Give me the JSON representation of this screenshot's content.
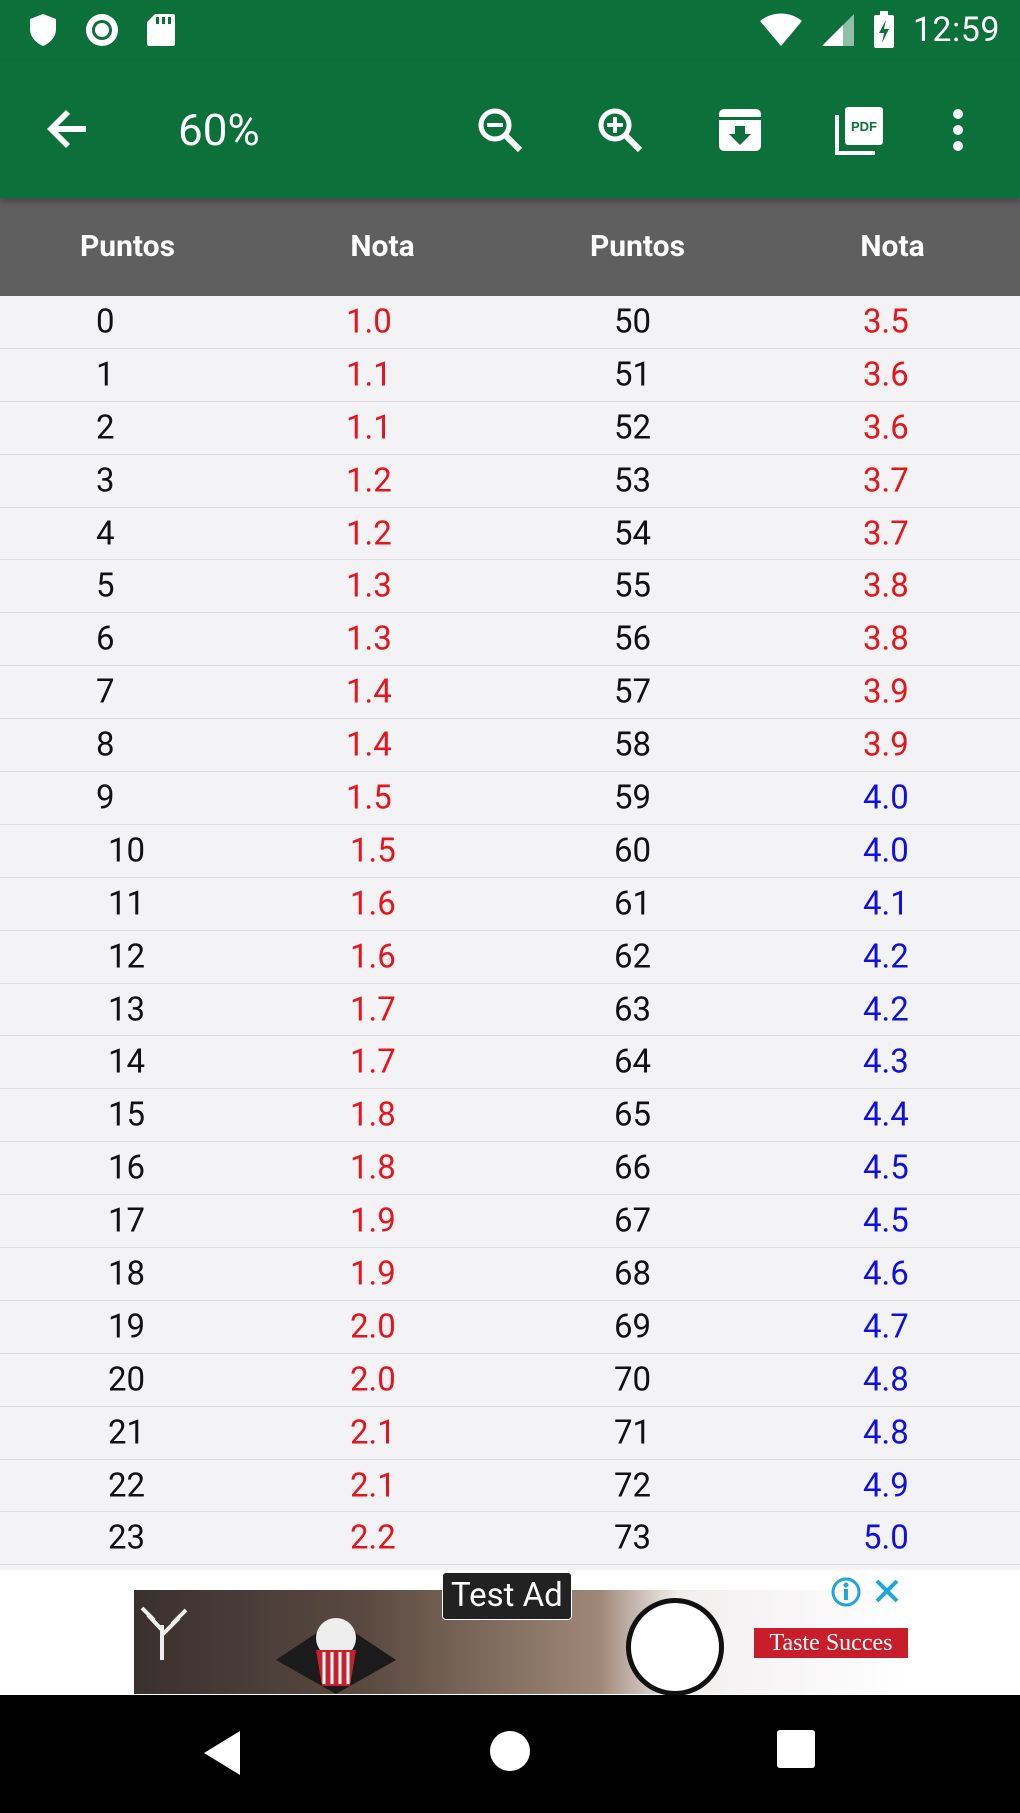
{
  "status_bar": {
    "time": "12:59"
  },
  "app_bar": {
    "zoom_label": "60%"
  },
  "table": {
    "headers": [
      "Puntos",
      "Nota",
      "Puntos",
      "Nota"
    ],
    "rows": [
      [
        "0",
        "1.0",
        "50",
        "3.5"
      ],
      [
        "1",
        "1.1",
        "51",
        "3.6"
      ],
      [
        "2",
        "1.1",
        "52",
        "3.6"
      ],
      [
        "3",
        "1.2",
        "53",
        "3.7"
      ],
      [
        "4",
        "1.2",
        "54",
        "3.7"
      ],
      [
        "5",
        "1.3",
        "55",
        "3.8"
      ],
      [
        "6",
        "1.3",
        "56",
        "3.8"
      ],
      [
        "7",
        "1.4",
        "57",
        "3.9"
      ],
      [
        "8",
        "1.4",
        "58",
        "3.9"
      ],
      [
        "9",
        "1.5",
        "59",
        "4.0"
      ],
      [
        "10",
        "1.5",
        "60",
        "4.0"
      ],
      [
        "11",
        "1.6",
        "61",
        "4.1"
      ],
      [
        "12",
        "1.6",
        "62",
        "4.2"
      ],
      [
        "13",
        "1.7",
        "63",
        "4.2"
      ],
      [
        "14",
        "1.7",
        "64",
        "4.3"
      ],
      [
        "15",
        "1.8",
        "65",
        "4.4"
      ],
      [
        "16",
        "1.8",
        "66",
        "4.5"
      ],
      [
        "17",
        "1.9",
        "67",
        "4.5"
      ],
      [
        "18",
        "1.9",
        "68",
        "4.6"
      ],
      [
        "19",
        "2.0",
        "69",
        "4.7"
      ],
      [
        "20",
        "2.0",
        "70",
        "4.8"
      ],
      [
        "21",
        "2.1",
        "71",
        "4.8"
      ],
      [
        "22",
        "2.1",
        "72",
        "4.9"
      ],
      [
        "23",
        "2.2",
        "73",
        "5.0"
      ]
    ],
    "colors": {
      "fail": "#e8141b",
      "pass": "#1010e0"
    },
    "pass_threshold": 4.0
  },
  "ad": {
    "label": "Test Ad",
    "brand_text": "Taste Succes"
  },
  "colors": {
    "primary": "#0b703a",
    "header_bg": "#5f5f5f"
  }
}
